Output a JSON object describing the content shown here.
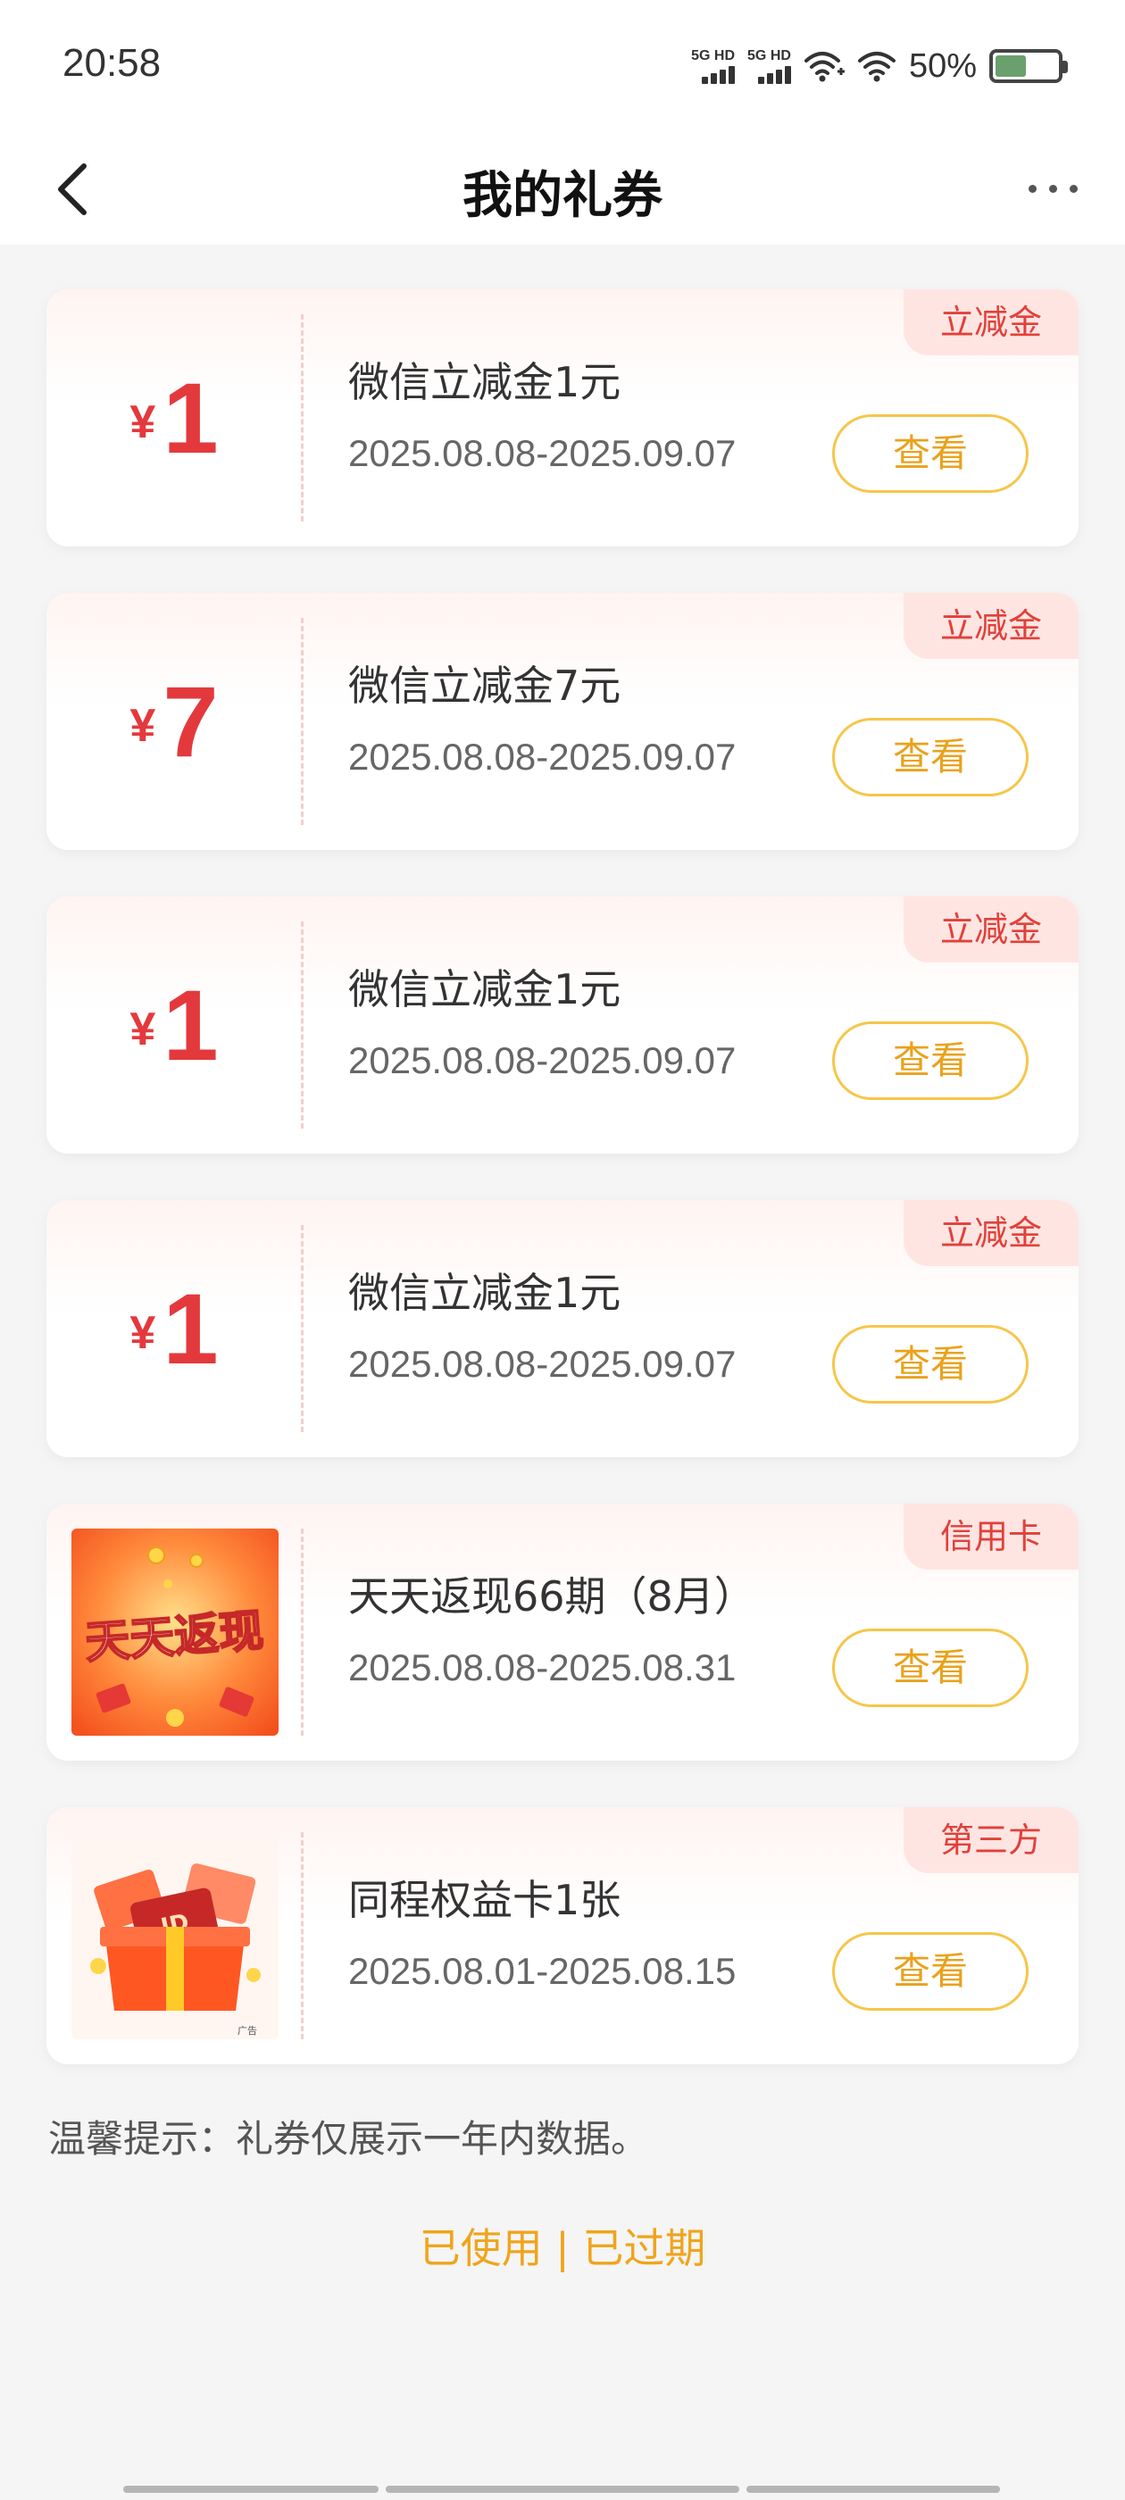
{
  "status": {
    "time": "20:58",
    "sim1": "5G HD",
    "sim2": "5G HD",
    "battery": "50%",
    "battery_level": 0.5
  },
  "header": {
    "title": "我的礼券",
    "back_icon": "chevron-left-icon",
    "more_icon": "more-horizontal-icon"
  },
  "coupons": [
    {
      "tag": "立减金",
      "currency": "¥",
      "amount": "1",
      "title": "微信立减金1元",
      "date": "2025.08.08-2025.09.07",
      "button": "查看"
    },
    {
      "tag": "立减金",
      "currency": "¥",
      "amount": "7",
      "title": "微信立减金7元",
      "date": "2025.08.08-2025.09.07",
      "button": "查看"
    },
    {
      "tag": "立减金",
      "currency": "¥",
      "amount": "1",
      "title": "微信立减金1元",
      "date": "2025.08.08-2025.09.07",
      "button": "查看"
    },
    {
      "tag": "立减金",
      "currency": "¥",
      "amount": "1",
      "title": "微信立减金1元",
      "date": "2025.08.08-2025.09.07",
      "button": "查看"
    },
    {
      "tag": "信用卡",
      "thumb_text": "天天返现",
      "title": "天天返现66期（8月）",
      "date": "2025.08.08-2025.08.31",
      "button": "查看"
    },
    {
      "tag": "第三方",
      "thumb_text": "ID",
      "thumb_badge": "广告",
      "title": "同程权益卡1张",
      "date": "2025.08.01-2025.08.15",
      "button": "查看"
    }
  ],
  "footer": {
    "tip": "温馨提示：礼券仅展示一年内数据。",
    "used_link": "已使用",
    "separator": "|",
    "expired_link": "已过期"
  },
  "colors": {
    "accent_red": "#e4393c",
    "accent_orange": "#f0a41c",
    "tag_bg": "#ffe5e2"
  }
}
